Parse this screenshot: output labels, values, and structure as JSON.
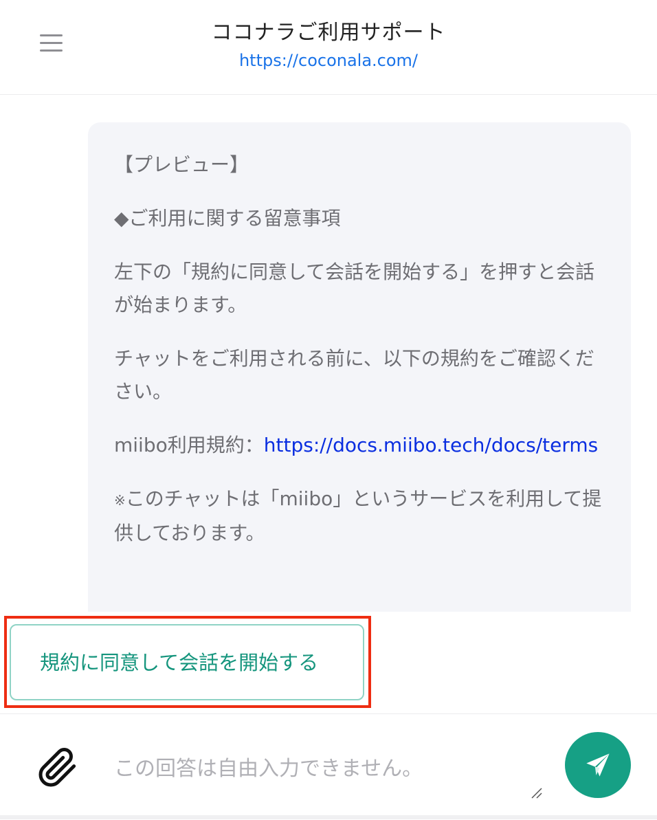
{
  "header": {
    "title": "ココナラご利用サポート",
    "link": "https://coconala.com/"
  },
  "message": {
    "preview": "【プレビュー】",
    "notice_heading": "◆ご利用に関する留意事項",
    "instruction": "左下の「規約に同意して会話を開始する」を押すと会話が始まります。",
    "confirm": "チャットをご利用される前に、以下の規約をご確認ください。",
    "terms_label": "miibo利用規約：",
    "terms_link": "https://docs.miibo.tech/docs/terms",
    "service_note_mark": "※",
    "service_note": "このチャットは「miibo」というサービスを利用して提供しております。"
  },
  "actions": {
    "agree_button": "規約に同意して会話を開始する"
  },
  "input": {
    "placeholder": "この回答は自由入力できません。"
  },
  "icons": {
    "menu": "hamburger-menu-icon",
    "attach": "paperclip-icon",
    "send": "paper-plane-icon"
  },
  "colors": {
    "accent": "#16a085",
    "link": "#1a73e8",
    "highlight_border": "#ee2d12",
    "bubble_bg": "#f4f5f9"
  }
}
